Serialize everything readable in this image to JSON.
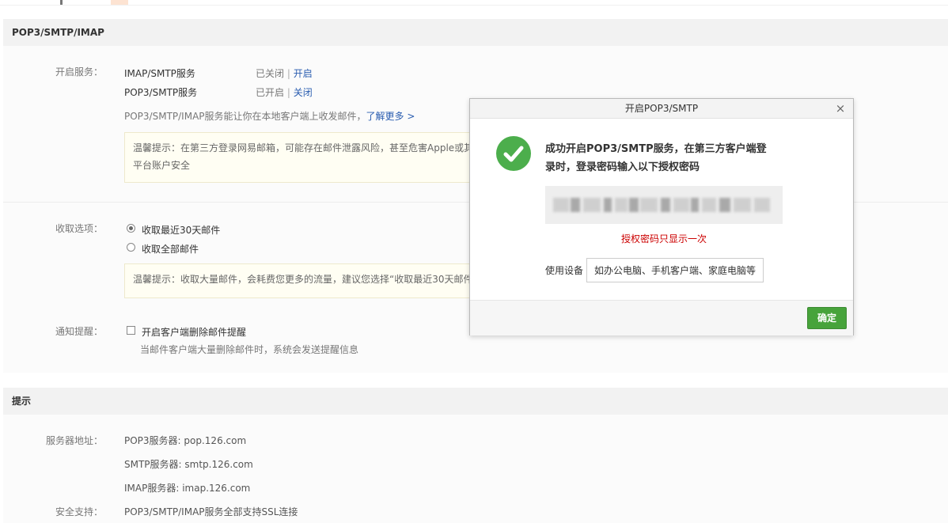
{
  "section1": {
    "title": "POP3/SMTP/IMAP",
    "service_label": "开启服务：",
    "services": [
      {
        "name": "IMAP/SMTP服务",
        "status": "已关闭",
        "sep": "|",
        "action": "开启"
      },
      {
        "name": "POP3/SMTP服务",
        "status": "已开启",
        "sep": "|",
        "action": "关闭"
      }
    ],
    "desc": "POP3/SMTP/IMAP服务能让你在本地客户端上收发邮件，",
    "learn_more": "了解更多 >",
    "tip1_line1": "温馨提示：在第三方登录网易邮箱，可能存在邮件泄露风险，甚至危害Apple或其",
    "tip1_line2": "平台账户安全",
    "receive_label": "收取选项：",
    "receive_options": [
      "收取最近30天邮件",
      "收取全部邮件"
    ],
    "tip2": "温馨提示：收取大量邮件，会耗费您更多的流量，建议您选择“收取最近30天邮件”",
    "notify_label": "通知提醒：",
    "notify_option": "开启客户端删除邮件提醒",
    "notify_desc": "当邮件客户端大量删除邮件时，系统会发送提醒信息"
  },
  "section2": {
    "title": "提示",
    "server_label": "服务器地址：",
    "servers": [
      "POP3服务器: pop.126.com",
      "SMTP服务器: smtp.126.com",
      "IMAP服务器: imap.126.com"
    ],
    "security_label": "安全支持：",
    "security_value": "POP3/SMTP/IMAP服务全部支持SSL连接"
  },
  "modal": {
    "title": "开启POP3/SMTP",
    "close_glyph": "×",
    "success_line1": "成功开启POP3/SMTP服务，在第三方客户端登",
    "success_line2": "录时，登录密码输入以下授权密码",
    "note": "授权密码只显示一次",
    "device_label": "使用设备",
    "device_placeholder": "如办公电脑、手机客户端、家庭电脑等",
    "ok_label": "确定"
  },
  "colors": {
    "accent_link": "#2a5db0",
    "warning_red": "#cc0000",
    "success_green": "#4cae4c",
    "confirm_button": "#47a33b"
  },
  "icons": {
    "success": "check-circle-icon",
    "close": "close-icon"
  }
}
